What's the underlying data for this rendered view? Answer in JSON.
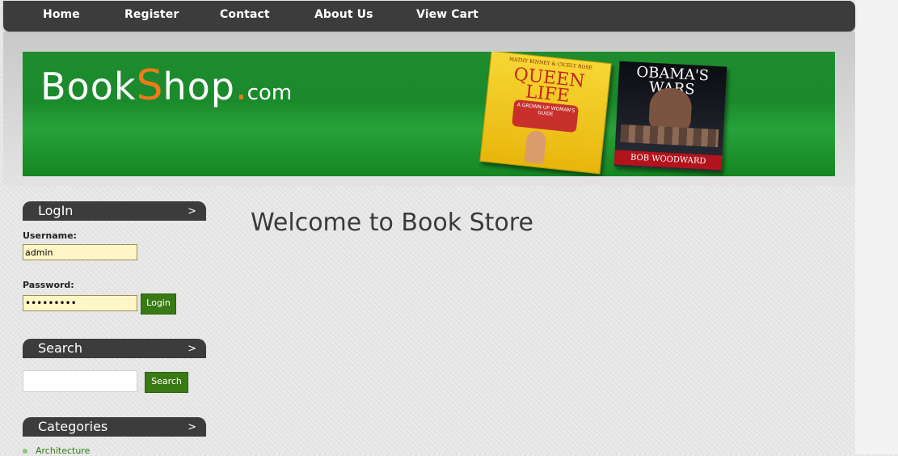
{
  "nav": {
    "home": "Home",
    "register": "Register",
    "contact": "Contact",
    "about": "About Us",
    "cart": "View Cart"
  },
  "logo": {
    "part1": "Book",
    "s": "S",
    "part2": "hop",
    "dot": ".",
    "com": "com"
  },
  "banner_books": [
    {
      "title": "QUEEN LIFE",
      "sub": "MATHY KINNEY & CICELY ROSE",
      "tag": "A GROWN-UP WOMAN'S GUIDE"
    },
    {
      "title": "OBAMA'S WARS",
      "author": "BOB WOODWARD"
    }
  ],
  "login": {
    "title": "LogIn",
    "arrow": ">",
    "username_label": "Username:",
    "username_value": "admin",
    "password_label": "Password:",
    "password_value": "•••••••••",
    "button": "Login"
  },
  "search": {
    "title": "Search",
    "arrow": ">",
    "button": "Search",
    "value": ""
  },
  "categories": {
    "title": "Categories",
    "arrow": ">",
    "items": [
      "Architecture"
    ]
  },
  "main": {
    "welcome": "Welcome to Book Store"
  }
}
